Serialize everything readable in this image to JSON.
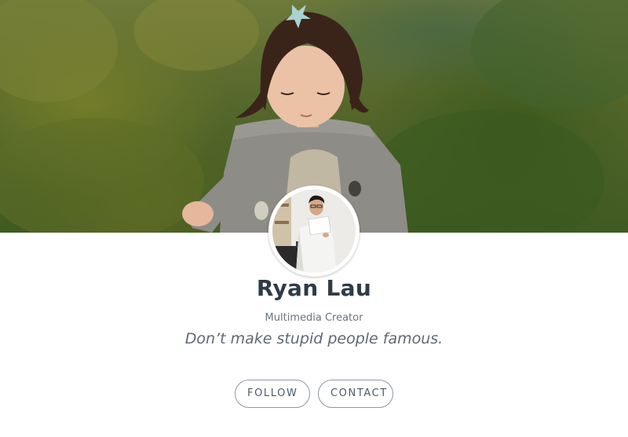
{
  "profile": {
    "name": "Ryan Lau",
    "role": "Multimedia Creator",
    "tagline": "Don’t make stupid people famous."
  },
  "actions": {
    "follow_label": "FOLLOW",
    "contact_label": "CONTACT"
  },
  "colors": {
    "name_text": "#2f3b47",
    "secondary_text": "#6a7480",
    "button_border": "#8e99a4",
    "background": "#ffffff"
  }
}
